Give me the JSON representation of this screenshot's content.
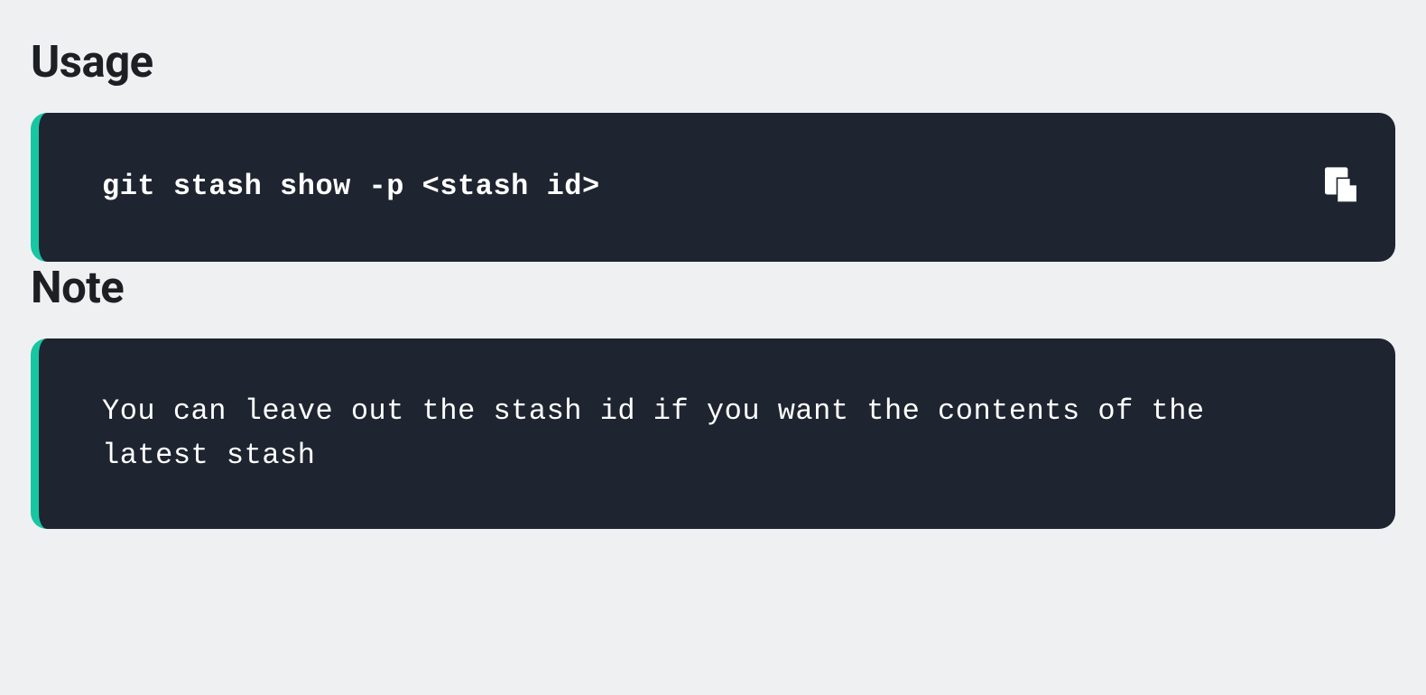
{
  "sections": {
    "usage": {
      "heading": "Usage",
      "code": "git stash show -p <stash id>"
    },
    "note": {
      "heading": "Note",
      "text": "You can leave out the stash id if you want the contents of the latest stash"
    }
  }
}
